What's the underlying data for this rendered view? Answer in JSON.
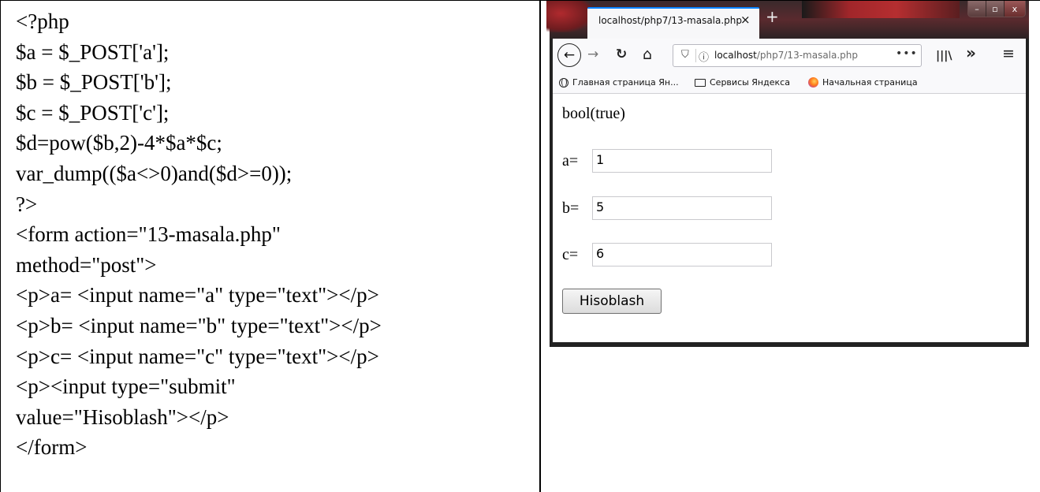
{
  "document": {
    "code_lines": [
      "<?php",
      "$a = $_POST['a'];",
      "$b = $_POST['b'];",
      "$c = $_POST['c'];",
      "$d=pow($b,2)-4*$a*$c;",
      "var_dump(($a<>0)and($d>=0));",
      "?>",
      "<form action=\"13-masala.php\"",
      "method=\"post\">",
      "<p>a= <input name=\"a\" type=\"text\"></p>",
      "<p>b= <input name=\"b\" type=\"text\"></p>",
      "<p>c= <input name=\"c\" type=\"text\"></p>",
      "<p><input type=\"submit\"",
      "value=\"Hisoblash\"></p>",
      "</form>"
    ]
  },
  "browser": {
    "tab": {
      "title": "localhost/php7/13-masala.php",
      "close_icon": "×",
      "new_tab_icon": "+"
    },
    "window_controls": {
      "minimize": "–",
      "maximize": "▫",
      "close": "x"
    },
    "nav": {
      "back_icon": "←",
      "forward_icon": "→",
      "reload_icon": "↻",
      "home_icon": "⌂",
      "library_icon": "|||\\",
      "overflow_icon": "»",
      "menu_icon": "≡"
    },
    "url": {
      "shield_icon": "⛉",
      "info_icon": "ⓘ",
      "host": "localhost",
      "path": "/php7/13-masala.php",
      "actions_icon": "•••"
    },
    "bookmarks": [
      {
        "label": "Главная страница Ян...",
        "icon": "globe-icon"
      },
      {
        "label": "Сервисы Яндекса",
        "icon": "folder-icon"
      },
      {
        "label": "Начальная страница",
        "icon": "firefox-icon"
      }
    ],
    "page": {
      "result": "bool(true)",
      "fields": [
        {
          "label": "a=",
          "value": "1"
        },
        {
          "label": "b=",
          "value": "5"
        },
        {
          "label": "c=",
          "value": "6"
        }
      ],
      "submit_label": "Hisoblash"
    },
    "colors": {
      "tab_accent": "#0a84ff",
      "frame": "#5a2a2e"
    }
  }
}
